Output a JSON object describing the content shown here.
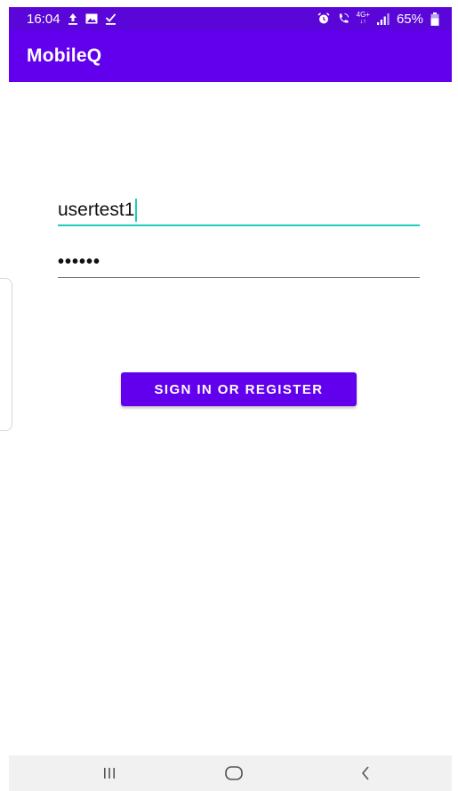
{
  "status_bar": {
    "time": "16:04",
    "battery": "65%",
    "network": "4G+",
    "icons_left": [
      "upload-icon",
      "image-icon",
      "download-done-icon"
    ],
    "icons_right": [
      "alarm-icon",
      "call-icon",
      "network-icon",
      "signal-icon",
      "battery-icon"
    ]
  },
  "app_bar": {
    "title": "MobileQ",
    "color": "#6200ee"
  },
  "login": {
    "username_value": "usertest1",
    "password_value": "••••••",
    "accent_color": "#1ccfb7"
  },
  "actions": {
    "sign_in_label": "SIGN IN OR REGISTER"
  },
  "nav_bar": {
    "icons": [
      "recent-apps-icon",
      "home-icon",
      "back-icon"
    ]
  }
}
